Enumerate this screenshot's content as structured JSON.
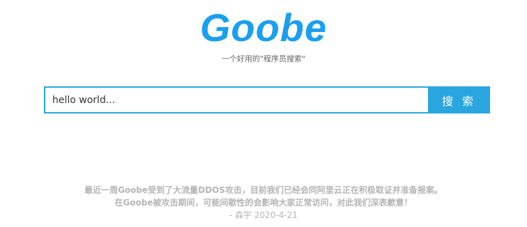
{
  "brand": {
    "logo_text": "Goobe",
    "tagline": "一个好用的\"程序员搜索\"",
    "accent_color": "#1a9ff0"
  },
  "search": {
    "placeholder": "hello world...",
    "button_label": "搜 索",
    "button_color": "#29a6e0"
  },
  "notice": {
    "line1": "最近一周Goobe受到了大流量DDOS攻击，目前我们已经会同阿里云正在积极取证并准备报案。",
    "line2": "在Goobe被攻击期间，可能间歇性的会影响大家正常访问，对此我们深表歉意！",
    "signature": "- 森宇 2020-4-21"
  }
}
